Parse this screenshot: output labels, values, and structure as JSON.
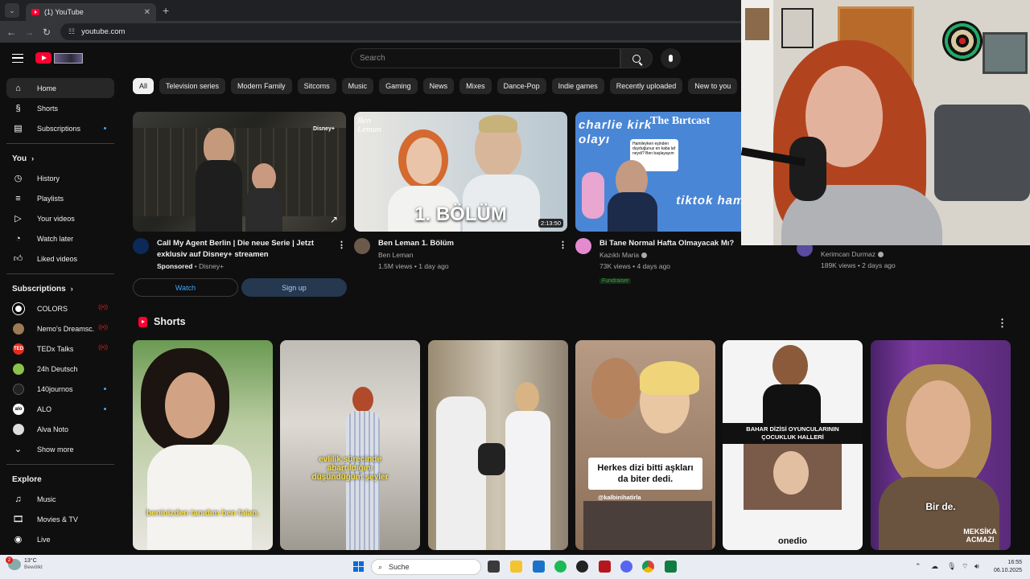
{
  "browser": {
    "tab_title": "(1) YouTube",
    "url": "youtube.com",
    "new_tab": "+"
  },
  "search": {
    "placeholder": "Search"
  },
  "sidebar": {
    "primary": [
      {
        "label": "Home",
        "icon": "home-icon"
      },
      {
        "label": "Shorts",
        "icon": "shorts-icon"
      },
      {
        "label": "Subscriptions",
        "icon": "subscriptions-icon"
      }
    ],
    "you_heading": "You",
    "you_items": [
      {
        "label": "History"
      },
      {
        "label": "Playlists"
      },
      {
        "label": "Your videos"
      },
      {
        "label": "Watch later"
      },
      {
        "label": "Liked videos"
      }
    ],
    "subs_heading": "Subscriptions",
    "subs": [
      {
        "label": "COLORS",
        "avatar": "#ffffff",
        "badge": "live"
      },
      {
        "label": "Nemo's Dreamsc...",
        "avatar": "#9c7a55",
        "badge": "live"
      },
      {
        "label": "TEDx Talks",
        "avatar": "#e62b1e",
        "avatar_text": "TED",
        "badge": "live"
      },
      {
        "label": "24h Deutsch",
        "avatar": "#8bc34a",
        "badge": ""
      },
      {
        "label": "140journos",
        "avatar": "#222222",
        "badge": "dot"
      },
      {
        "label": "ALO",
        "avatar": "#ffffff",
        "avatar_text": "alo",
        "badge": "dot"
      },
      {
        "label": "Alva Noto",
        "avatar": "#dddddd",
        "badge": ""
      }
    ],
    "show_more": "Show more",
    "explore_heading": "Explore",
    "explore_items": [
      {
        "label": "Music"
      },
      {
        "label": "Movies & TV"
      },
      {
        "label": "Live"
      }
    ]
  },
  "chips": [
    "All",
    "Television series",
    "Modern Family",
    "Sitcoms",
    "Music",
    "Gaming",
    "News",
    "Mixes",
    "Dance-Pop",
    "Indie games",
    "Recently uploaded",
    "New to you"
  ],
  "videos": [
    {
      "title": "Call My Agent Berlin | Die neue Serie | Jetzt exklusiv auf Disney+ streamen",
      "sponsored": "Sponsored",
      "channel": "Disney+",
      "watch": "Watch",
      "signup": "Sign up",
      "badge": "Disney+"
    },
    {
      "title": "Ben Leman 1. Bölüm",
      "channel": "Ben Leman",
      "stats": "1.5M views • 1 day ago",
      "duration": "2:13:50",
      "thumb_text": "1. BÖLÜM",
      "thumb_logo": "Ben Leman"
    },
    {
      "title": "Bi Tane Normal Hafta Olmayacak Mı?",
      "channel": "Kazıklı Maria",
      "stats": "73K views • 4 days ago",
      "fundraiser": "Fundraiser",
      "thumb_top": "charlie kirk olayı",
      "thumb_right": "The Bırtcast",
      "thumb_bottom": "tiktok hamile ak",
      "thumb_bubble": "Hamileyken eşinden duyduğunuz en kaba laf neydi? Ben başlayayım"
    },
    {
      "channel": "Kerimcan Durmaz",
      "stats": "189K views • 2 days ago"
    }
  ],
  "shorts": {
    "heading": "Shorts",
    "items": [
      {
        "caption": "beninizden tanıdım ben falan."
      },
      {
        "caption": "evlilik sürecinde abartıldığını düşündüğüm şeyler"
      },
      {
        "caption": ""
      },
      {
        "caption": "Herkes dizi bitti aşkları da biter dedi.",
        "handle": "@kalbinihatirla"
      },
      {
        "caption": "BAHAR DİZİSİ OYUNCULARININ ÇOCUKLUK HALLERİ",
        "brand": "onedio"
      },
      {
        "caption": "Bir de.",
        "brand": "MEKSİKA ACMAZI"
      }
    ]
  },
  "taskbar": {
    "temp": "13°C",
    "condition": "Bewölkt",
    "search": "Suche",
    "time": "16:55",
    "date": "06.10.2025",
    "weather_badge": "2"
  }
}
